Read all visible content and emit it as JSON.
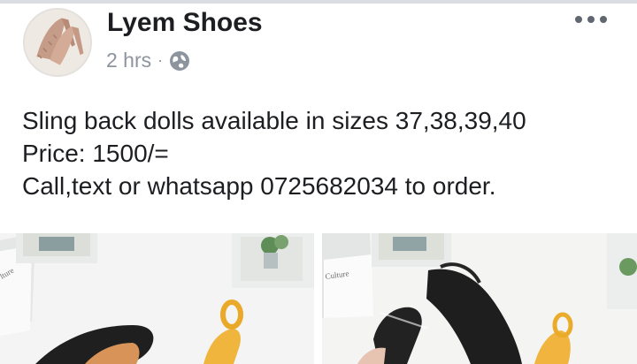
{
  "post": {
    "page_name": "Lyem Shoes",
    "time": "2 hrs",
    "separator": "·",
    "privacy_icon": "globe-icon",
    "more_icon": "more-options-icon",
    "text_lines": [
      "Sling back dolls available in sizes 37,38,39,40",
      "Price: 1500/=",
      "Call,text or whatsapp 0725682034 to order."
    ]
  },
  "photos": [
    {
      "name": "shoe-photo-1",
      "book_text": "lture"
    },
    {
      "name": "shoe-photo-2",
      "book_text": "Culture"
    }
  ],
  "colors": {
    "text": "#1c1e21",
    "meta": "#8d949e",
    "divider": "#dadde1"
  }
}
